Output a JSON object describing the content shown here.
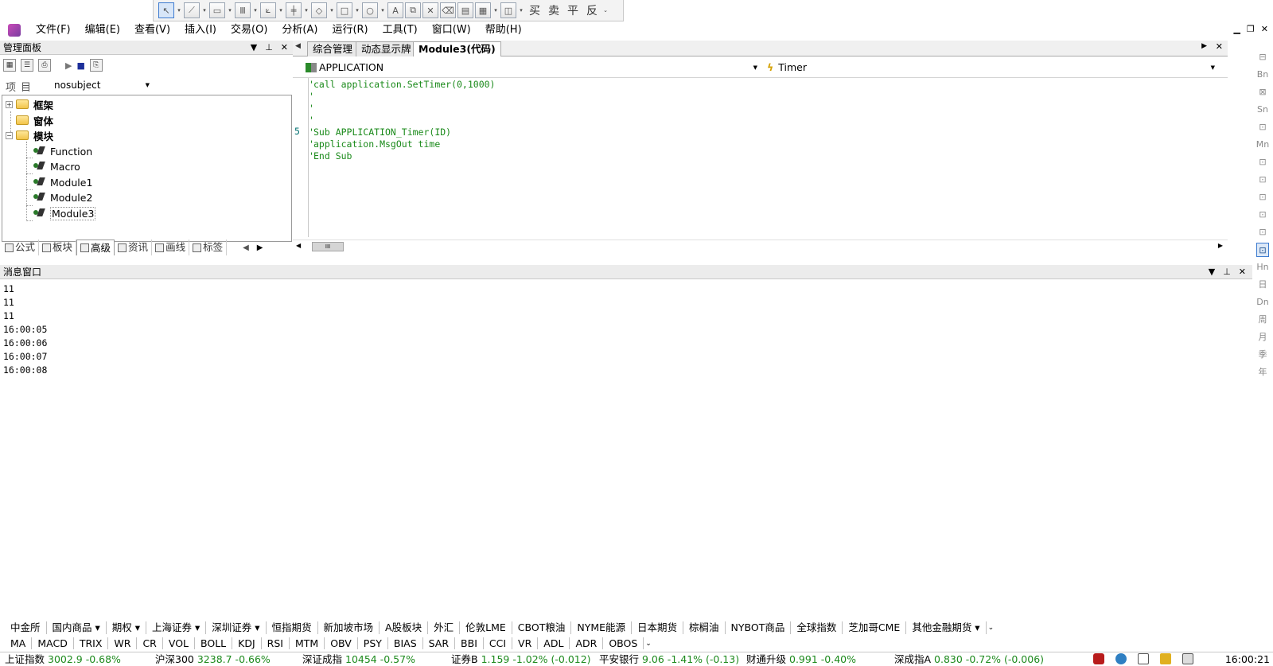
{
  "menu": [
    "文件(F)",
    "编辑(E)",
    "查看(V)",
    "插入(I)",
    "交易(O)",
    "分析(A)",
    "运行(R)",
    "工具(T)",
    "窗口(W)",
    "帮助(H)"
  ],
  "toolbar": {
    "chars": [
      "买",
      "卖",
      "平",
      "反"
    ]
  },
  "left_panel": {
    "title": "管理面板",
    "subject_label": "项目",
    "subject_value": "nosubject",
    "tree": {
      "frame": "框架",
      "window": "窗体",
      "module": "模块",
      "children": [
        "Function",
        "Macro",
        "Module1",
        "Module2",
        "Module3"
      ]
    },
    "tabs": [
      "公式",
      "板块",
      "高级",
      "资讯",
      "画线",
      "标签"
    ]
  },
  "editor": {
    "tabs": [
      "综合管理",
      "动态显示牌",
      "Module3(代码)"
    ],
    "object_combo": "APPLICATION",
    "event_combo": "Timer",
    "gutter_number": "5",
    "lines": [
      "call application.SetTimer(0,1000)",
      "",
      "",
      "",
      "Sub APPLICATION_Timer(ID)",
      "application.MsgOut time",
      "End Sub"
    ]
  },
  "right_bar": [
    "Bn",
    "Sn",
    "Mn",
    "Hn",
    "日",
    "Dn",
    "周",
    "月",
    "季",
    "年"
  ],
  "message_window": {
    "title": "消息窗口",
    "lines": [
      "11",
      "11",
      "11",
      "16:00:05",
      "16:00:06",
      "16:00:07",
      "16:00:08"
    ]
  },
  "market_tabs": [
    "中金所",
    "国内商品 ▾",
    "期权 ▾",
    "上海证券 ▾",
    "深圳证券 ▾",
    "恒指期货",
    "新加坡市场",
    "A股板块",
    "外汇",
    "伦敦LME",
    "CBOT粮油",
    "NYME能源",
    "日本期货",
    "棕榈油",
    "NYBOT商品",
    "全球指数",
    "芝加哥CME",
    "其他金融期货 ▾"
  ],
  "indicator_tabs": [
    "MA",
    "MACD",
    "TRIX",
    "WR",
    "CR",
    "VOL",
    "BOLL",
    "KDJ",
    "RSI",
    "MTM",
    "OBV",
    "PSY",
    "BIAS",
    "SAR",
    "BBI",
    "CCI",
    "VR",
    "ADL",
    "ADR",
    "OBOS"
  ],
  "status": {
    "items": [
      {
        "name": "上证指数",
        "value": "3002.9 -0.68%"
      },
      {
        "name": "沪深300",
        "value": "3238.7 -0.66%"
      },
      {
        "name": "深证成指",
        "value": "10454 -0.57%"
      },
      {
        "name": "证券B",
        "value": "1.159 -1.02% (-0.012)"
      },
      {
        "name": "平安银行",
        "value": "9.06 -1.41% (-0.13)"
      },
      {
        "name": "财通升级",
        "value": "0.991 -0.40%"
      },
      {
        "name": "深成指A",
        "value": "0.830 -0.72% (-0.006)"
      }
    ],
    "time": "16:00:21"
  },
  "colors": {
    "code_green": "#1a8a1a",
    "price_green": "#1d8a1d",
    "selection_blue": "#3d7bd0"
  }
}
